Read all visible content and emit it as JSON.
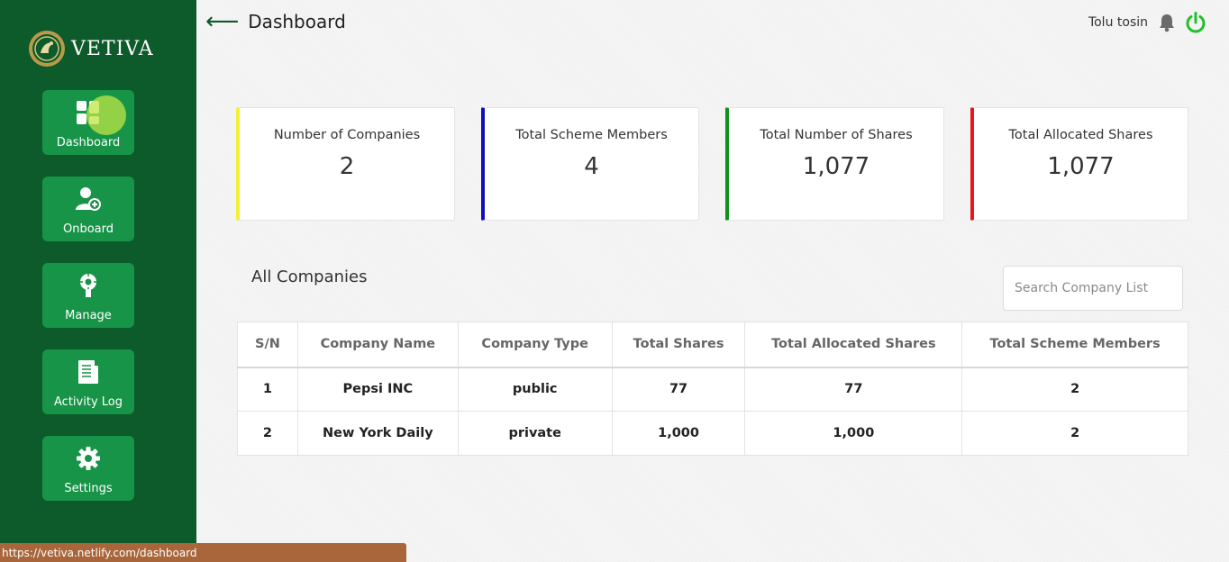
{
  "brand": {
    "name": "VETIVA"
  },
  "sidebar": {
    "items": [
      {
        "label": "Dashboard",
        "icon": "dashboard-icon"
      },
      {
        "label": "Onboard",
        "icon": "add-user-icon"
      },
      {
        "label": "Manage",
        "icon": "manage-icon"
      },
      {
        "label": "Activity Log",
        "icon": "activity-log-icon"
      },
      {
        "label": "Settings",
        "icon": "gear-icon"
      }
    ]
  },
  "header": {
    "back_arrow": "⟵",
    "title": "Dashboard",
    "user_name": "Tolu tosin"
  },
  "stats": [
    {
      "label": "Number of Companies",
      "value": "2",
      "accent": "#f4f036"
    },
    {
      "label": "Total Scheme Members",
      "value": "4",
      "accent": "#1010b8"
    },
    {
      "label": "Total Number of Shares",
      "value": "1,077",
      "accent": "#10901c"
    },
    {
      "label": "Total Allocated Shares",
      "value": "1,077",
      "accent": "#e81717"
    }
  ],
  "companies": {
    "title": "All Companies",
    "search_placeholder": "Search Company List",
    "columns": [
      "S/N",
      "Company Name",
      "Company Type",
      "Total Shares",
      "Total Allocated Shares",
      "Total Scheme Members"
    ],
    "rows": [
      [
        "1",
        "Pepsi INC",
        "public",
        "77",
        "77",
        "2"
      ],
      [
        "2",
        "New York Daily",
        "private",
        "1,000",
        "1,000",
        "2"
      ]
    ]
  },
  "status_bar": {
    "url": "https://vetiva.netlify.com/dashboard"
  },
  "colors": {
    "sidebar": "#0d5a2b",
    "nav_button": "#179447",
    "power": "#22c02a"
  }
}
